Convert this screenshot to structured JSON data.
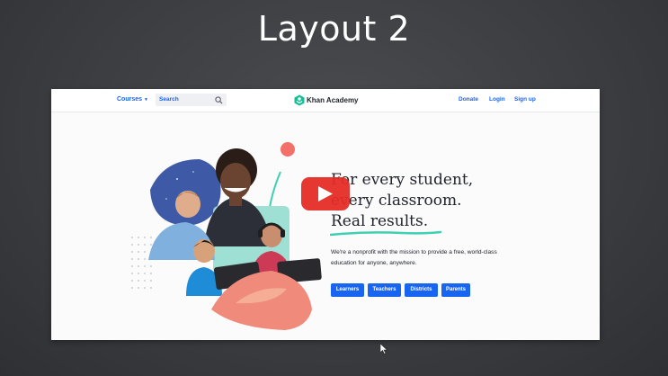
{
  "slide": {
    "title": "Layout 2"
  },
  "header": {
    "courses_label": "Courses",
    "search_placeholder": "Search",
    "brand_name": "Khan Academy",
    "donate_label": "Donate",
    "login_label": "Login",
    "signup_label": "Sign up"
  },
  "hero": {
    "headline_lines": [
      "For every student,",
      "every classroom.",
      "Real results."
    ],
    "description_lines": [
      "We're a nonprofit with the mission to provide a free, world-class",
      "education for anyone, anywhere."
    ],
    "buttons": [
      "Learners",
      "Teachers",
      "Districts",
      "Parents"
    ]
  },
  "colors": {
    "accent_blue": "#1865f2",
    "brand_green": "#14bf96",
    "video_play_red": "#e52d27"
  },
  "icons": [
    "search-icon",
    "khan-academy-logo-icon",
    "play-icon",
    "mouse-cursor-icon"
  ]
}
